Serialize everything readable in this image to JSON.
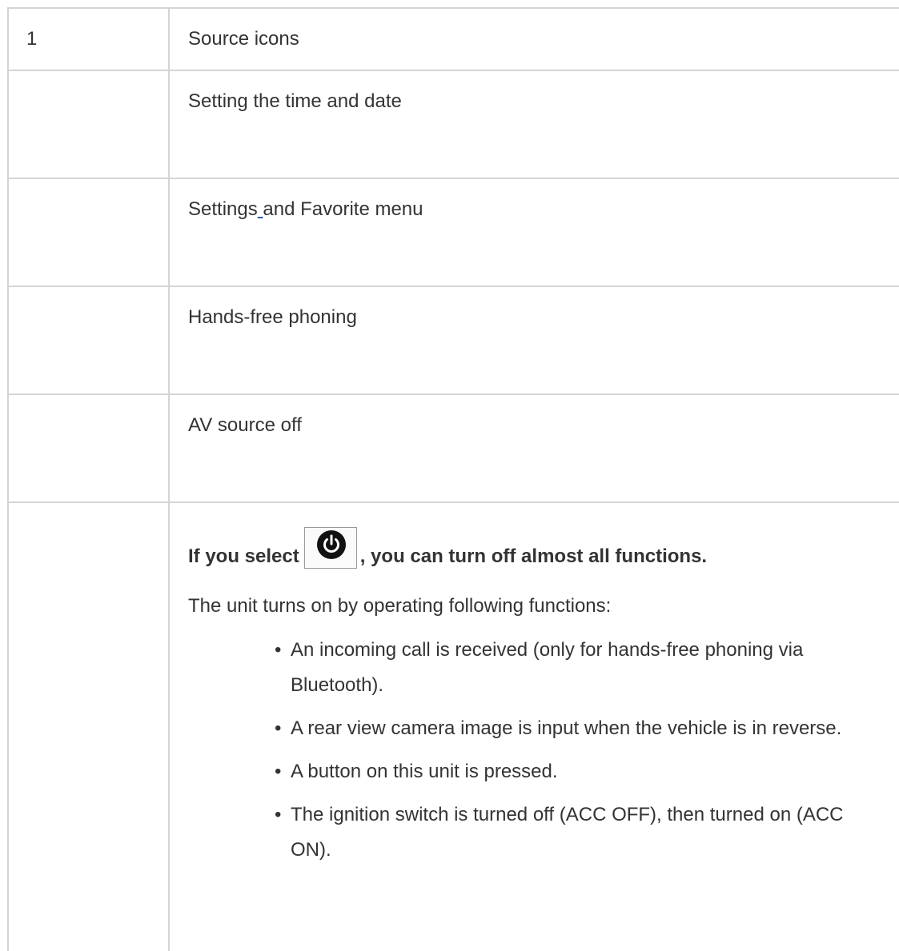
{
  "rows": [
    {
      "num": "1",
      "text_before": "Source icons"
    },
    {
      "num": "",
      "text_before": "Setting the time and date"
    },
    {
      "num": "",
      "text_before": "Settings",
      "text_link": " ",
      "text_after": "and Favorite menu"
    },
    {
      "num": "",
      "text_before": "Hands-free phoning"
    },
    {
      "num": "",
      "text_before": "AV source off"
    }
  ],
  "av_off": {
    "lead_before": "If you select ",
    "lead_after": ", you can turn off almost all functions.",
    "power_icon": "power-icon",
    "intro": "The unit turns on by operating following functions:",
    "functions": [
      "An incoming call is received (only for hands-free phoning via Bluetooth).",
      "A rear view camera image is input when the vehicle is in reverse.",
      "A button on this unit is pressed.",
      "The ignition switch is turned off (ACC OFF), then turned on (ACC ON)."
    ]
  },
  "bullet_char": "•"
}
